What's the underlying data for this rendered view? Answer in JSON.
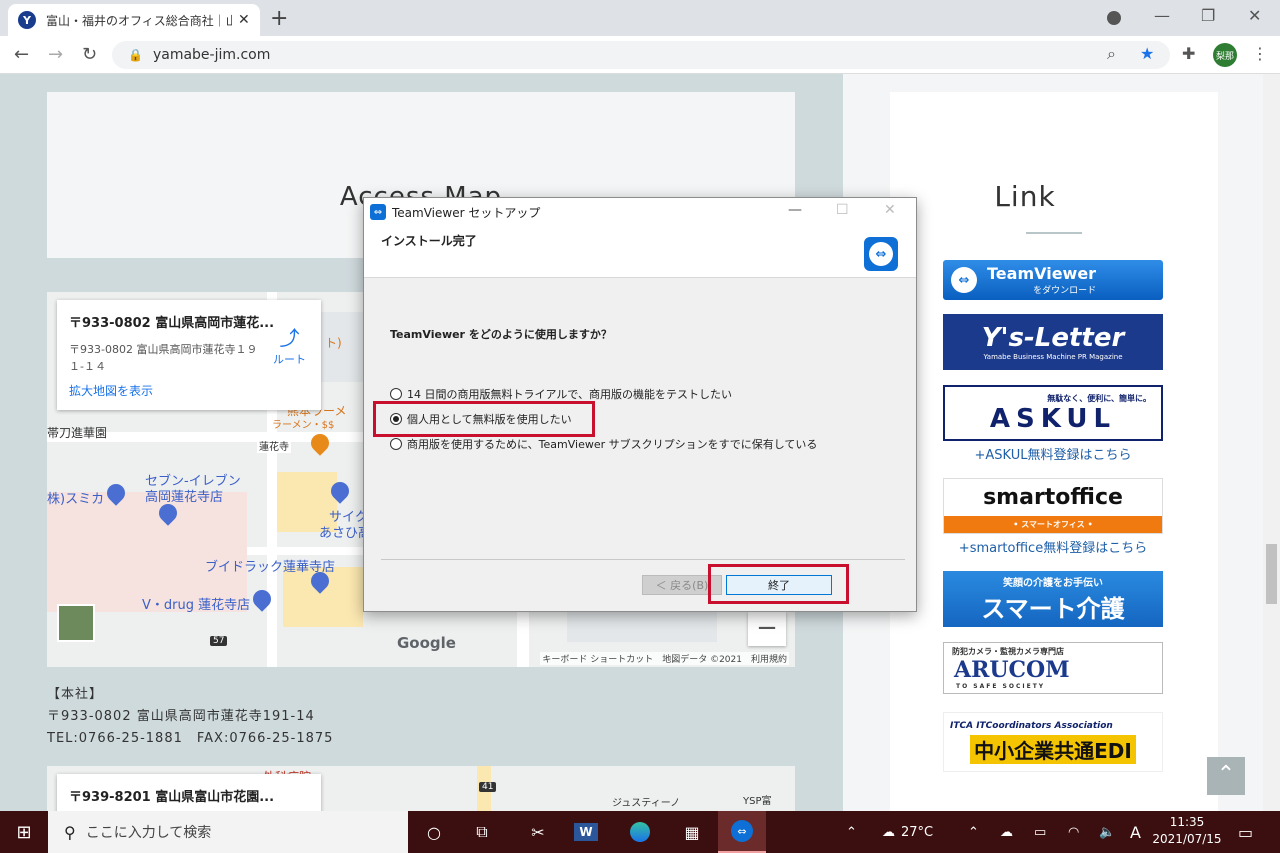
{
  "browser": {
    "tab_title": "富山・福井のオフィス総合商社｜山",
    "tab_favicon": "Y",
    "url": "yamabe-jim.com",
    "avatar_label": "梨那"
  },
  "page": {
    "access_title": "Access Map",
    "link_title": "Link",
    "map1": {
      "card_title": "〒933-0802 富山県高岡市蓮花...",
      "card_address": "〒933-0802 富山県高岡市蓮花寺１９１-１４",
      "card_link": "拡大地図を表示",
      "card_route": "ルート",
      "labels": {
        "l1": "帯刀進華園",
        "l2": "セブン-イレブン",
        "l3": "高岡蓮花寺店",
        "l4": "株)スミカ",
        "l5": "ブイドラック蓮華寺店",
        "l6": "V・drug 蓮花寺店",
        "l7": "熊本ラーメ",
        "l8": "ラーメン・$$",
        "l9": "蓮花寺",
        "l10": "サイク",
        "l11": "あさひ高",
        "l12": "ト)"
      },
      "google": "Google",
      "footer": "キーボード ショートカット　地図データ ©2021　利用規約",
      "zoom_minus": "−",
      "road_badge": "57"
    },
    "address": {
      "heading": "【本社】",
      "line1": "〒933-0802 富山県高岡市蓮花寺191-14",
      "line2": "TEL:0766-25-1881　FAX:0766-25-1875"
    },
    "map2": {
      "card_title": "〒939-8201 富山県富山市花園...",
      "labels": {
        "l1": "外科病院",
        "l2": "ジュスティーノ",
        "l3": "YSP富",
        "badge": "41"
      }
    },
    "banners": {
      "teamviewer_main": "TeamViewer",
      "teamviewer_sub": "をダウンロード",
      "ysletter_main": "Y's-Letter",
      "ysletter_sub": "Yamabe Business Machine PR Magazine",
      "askul_top": "無駄なく、便利に、簡単に。",
      "askul_main": "ASKUL",
      "askul_caption": "+ASKUL無料登録はこちら",
      "smartoffice_main": "smartoffice",
      "smartoffice_sub": "• スマートオフィス •",
      "smartoffice_caption": "+smartoffice無料登録はこちら",
      "kaigo_top": "笑顔の介護をお手伝い",
      "kaigo_main": "スマート介護",
      "arucom_top": "防犯カメラ・監視カメラ専門店",
      "arucom_main": "ARUCOM",
      "arucom_sub": "TO SAFE SOCIETY",
      "itca_top": "ITCA ITCoordinators Association",
      "itca_main": "中小企業共通EDI"
    }
  },
  "dialog": {
    "title": "TeamViewer セットアップ",
    "heading": "インストール完了",
    "question": "TeamViewer をどのように使用しますか？",
    "options": [
      {
        "label": "14 日間の商用版無料トライアルで、商用版の機能をテストしたい",
        "checked": false
      },
      {
        "label": "個人用として無料版を使用したい",
        "checked": true
      },
      {
        "label": "商用版を使用するために、TeamViewer サブスクリプションをすでに保有している",
        "checked": false
      }
    ],
    "back_button": "＜ 戻る(B)",
    "finish_button": "終了",
    "highlight_color": "#c8102e"
  },
  "taskbar": {
    "search_placeholder": "ここに入力して検索",
    "weather": "27°C",
    "ime": "A",
    "time": "11:35",
    "date": "2021/07/15"
  },
  "colors": {
    "teamviewer_blue": "#0e6fd6",
    "ysletter_navy": "#1c3a8c",
    "askul_navy": "#10226b",
    "smartoffice_orange": "#f07a10",
    "link_blue": "#1e5fa8"
  }
}
